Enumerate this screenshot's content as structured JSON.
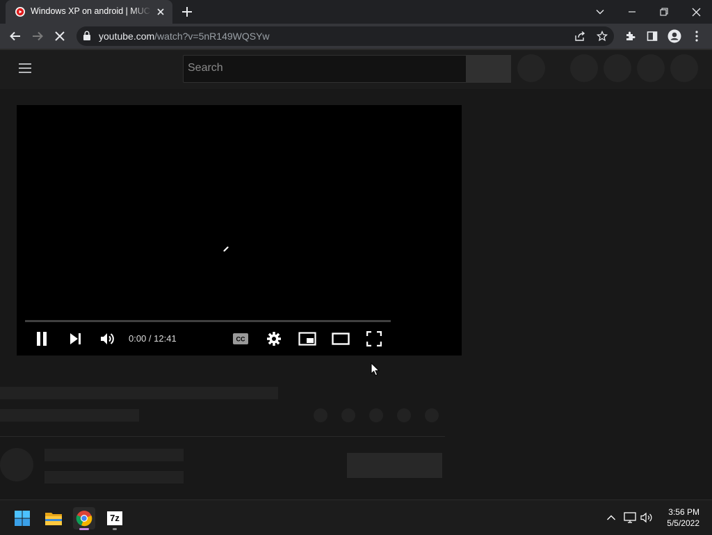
{
  "browser": {
    "tab": {
      "title": "Windows XP on android | MUCH",
      "favicon": "youtube-favicon"
    },
    "url_host": "youtube.com",
    "url_path": "/watch?v=5nR149WQSYw",
    "icons": [
      "back-icon",
      "forward-icon",
      "stop-icon",
      "lock-icon",
      "share-icon",
      "star-icon",
      "extensions-icon",
      "side-panel-icon",
      "profile-icon",
      "menu-icon",
      "minimize-icon",
      "restore-icon",
      "close-icon",
      "new-tab-icon",
      "tab-list-icon"
    ]
  },
  "youtube": {
    "search_placeholder": "Search",
    "player": {
      "time": "0:00 / 12:41",
      "progress_fraction": 0.0
    }
  },
  "taskbar": {
    "apps": [
      "start-icon",
      "file-explorer-icon",
      "chrome-icon",
      "7zip-icon"
    ],
    "sevenzip_label": "7z",
    "tray_icons": [
      "show-hidden-icons-icon",
      "network-icon",
      "volume-icon"
    ],
    "time": "3:56 PM",
    "date": "5/5/2022"
  },
  "colors": {
    "accent": "#ff0000",
    "background": "#181818",
    "chrome_toolbar": "#35363a"
  }
}
